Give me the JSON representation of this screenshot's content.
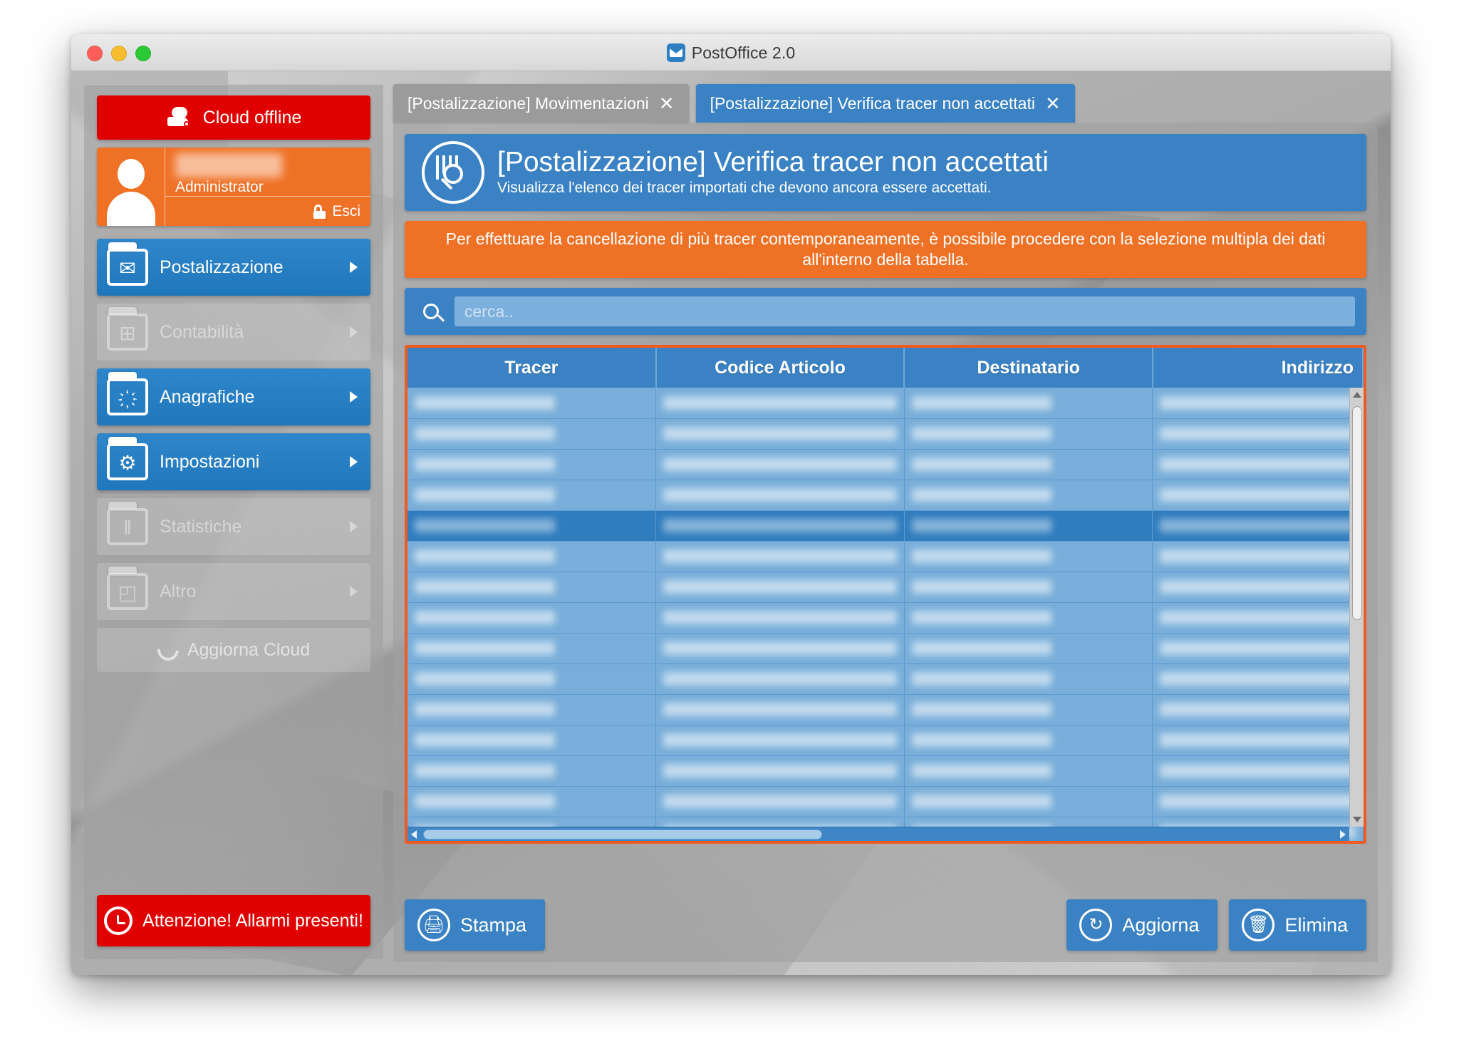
{
  "window": {
    "title": "PostOffice 2.0",
    "title_icon": "mail-icon",
    "traffic_lights": [
      "close",
      "minimize",
      "maximize"
    ]
  },
  "sidebar": {
    "cloud_status": {
      "label": "Cloud offline",
      "icon": "cloud-off-icon",
      "color": "#e00000"
    },
    "user": {
      "name": "",
      "role": "Administrator",
      "logout_label": "Esci",
      "logout_icon": "unlock-icon"
    },
    "menu": [
      {
        "label": "Postalizzazione",
        "icon": "mail-package-folder-icon",
        "enabled": true,
        "glyph": "✉"
      },
      {
        "label": "Contabilità",
        "icon": "calculator-folder-icon",
        "enabled": false,
        "glyph": "⊞"
      },
      {
        "label": "Anagrafiche",
        "icon": "people-folder-icon",
        "enabled": true,
        "glyph": "҉"
      },
      {
        "label": "Impostazioni",
        "icon": "gear-folder-icon",
        "enabled": true,
        "glyph": "⚙"
      },
      {
        "label": "Statistiche",
        "icon": "bar-chart-folder-icon",
        "enabled": false,
        "glyph": "‖"
      },
      {
        "label": "Altro",
        "icon": "puzzle-folder-icon",
        "enabled": false,
        "glyph": "◰"
      }
    ],
    "refresh_cloud": {
      "label": "Aggiorna Cloud",
      "icon": "refresh-icon"
    },
    "alarm": {
      "label": "Attenzione! Allarmi presenti!",
      "icon": "alarm-clock-icon",
      "color": "#e00000"
    }
  },
  "tabs": [
    {
      "label": "[Postalizzazione] Movimentazioni",
      "close": "✕",
      "active": false
    },
    {
      "label": "[Postalizzazione] Verifica tracer non accettati",
      "close": "✕",
      "active": true
    }
  ],
  "page": {
    "icon": "tracer-search-icon",
    "title": "[Postalizzazione] Verifica tracer non accettati",
    "subtitle": "Visualizza l'elenco dei tracer importati che devono ancora essere accettati.",
    "warning": "Per effettuare la cancellazione di più tracer contemporaneamente, è possibile procedere con la selezione multipla dei dati all'interno della tabella.",
    "accent_blue": "#3a82c4",
    "accent_orange": "#ef7126",
    "table_border": "#ef5a22"
  },
  "search": {
    "placeholder": "cerca..",
    "value": "",
    "icon": "search-icon"
  },
  "table": {
    "columns": [
      "Tracer",
      "Codice Articolo",
      "Destinatario",
      "Indirizzo"
    ],
    "rows": [
      {
        "selected": false,
        "redacted": true
      },
      {
        "selected": false,
        "redacted": true
      },
      {
        "selected": false,
        "redacted": true
      },
      {
        "selected": false,
        "redacted": true
      },
      {
        "selected": true,
        "redacted": true
      },
      {
        "selected": false,
        "redacted": true
      },
      {
        "selected": false,
        "redacted": true
      },
      {
        "selected": false,
        "redacted": true
      },
      {
        "selected": false,
        "redacted": true
      },
      {
        "selected": false,
        "redacted": true
      },
      {
        "selected": false,
        "redacted": true
      },
      {
        "selected": false,
        "redacted": true
      },
      {
        "selected": false,
        "redacted": true
      },
      {
        "selected": false,
        "redacted": true
      },
      {
        "selected": false,
        "redacted": true
      }
    ]
  },
  "footer": {
    "print": {
      "label": "Stampa",
      "icon": "printer-icon"
    },
    "refresh": {
      "label": "Aggiorna",
      "icon": "refresh-icon"
    },
    "delete": {
      "label": "Elimina",
      "icon": "trash-icon"
    }
  }
}
